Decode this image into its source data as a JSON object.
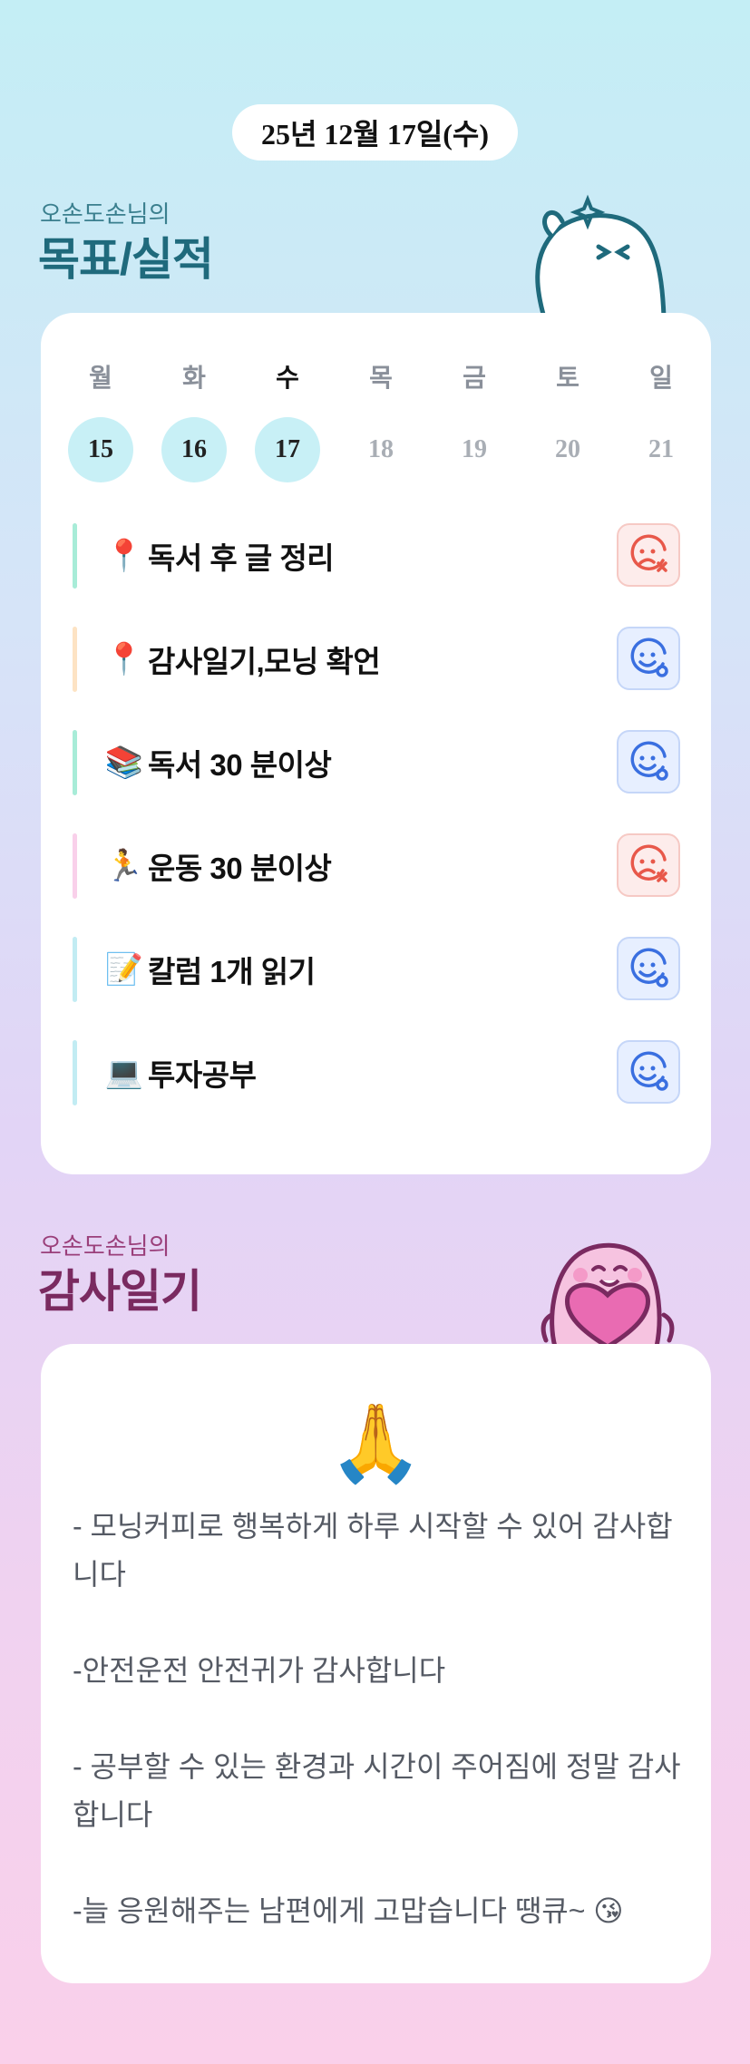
{
  "date": "25년 12월 17일(수)",
  "goals_section": {
    "subtitle": "오손도손님의",
    "title": "목표/실적"
  },
  "week": {
    "days": [
      {
        "label": "월",
        "num": "15",
        "done": true,
        "today": false
      },
      {
        "label": "화",
        "num": "16",
        "done": true,
        "today": false
      },
      {
        "label": "수",
        "num": "17",
        "done": true,
        "today": true
      },
      {
        "label": "목",
        "num": "18",
        "done": false,
        "today": false
      },
      {
        "label": "금",
        "num": "19",
        "done": false,
        "today": false
      },
      {
        "label": "토",
        "num": "20",
        "done": false,
        "today": false
      },
      {
        "label": "일",
        "num": "21",
        "done": false,
        "today": false
      }
    ]
  },
  "goals": [
    {
      "emoji": "📍",
      "text": "독서 후 글 정리",
      "status": "fail",
      "bar_color": "#a8ecd8"
    },
    {
      "emoji": "📍",
      "text": "감사일기,모닝 확언",
      "status": "done",
      "bar_color": "#fde3c4"
    },
    {
      "emoji": "📚",
      "text": "독서 30 분이상",
      "status": "done",
      "bar_color": "#a8ecd8"
    },
    {
      "emoji": "🏃",
      "text": "운동 30 분이상",
      "status": "fail",
      "bar_color": "#f9d0ea"
    },
    {
      "emoji": "📝",
      "text": "칼럼 1개 읽기",
      "status": "done",
      "bar_color": "#c2ecf3"
    },
    {
      "emoji": "💻",
      "text": "투자공부",
      "status": "done",
      "bar_color": "#c2ecf3"
    }
  ],
  "gratitude_section": {
    "subtitle": "오손도손님의",
    "title": "감사일기",
    "emoji": "🙏",
    "text": "- 모닝커피로 행복하게 하루 시작할 수 있어 감사합니다\n\n-안전운전 안전귀가 감사합니다\n\n- 공부할 수 있는 환경과 시간이 주어짐에 정말 감사합니다\n\n-늘 응원해주는 남편에게 고맙습니다 땡큐~ 😘"
  },
  "icons": {
    "fail": "sad-face-x-icon",
    "done": "smile-face-check-icon"
  },
  "colors": {
    "goals_title": "#1f6a7c",
    "gratitude_title": "#7a2a60",
    "done_day": "#c8f0f6",
    "fail_icon": "#e8584a",
    "done_icon": "#3a6fe0"
  }
}
